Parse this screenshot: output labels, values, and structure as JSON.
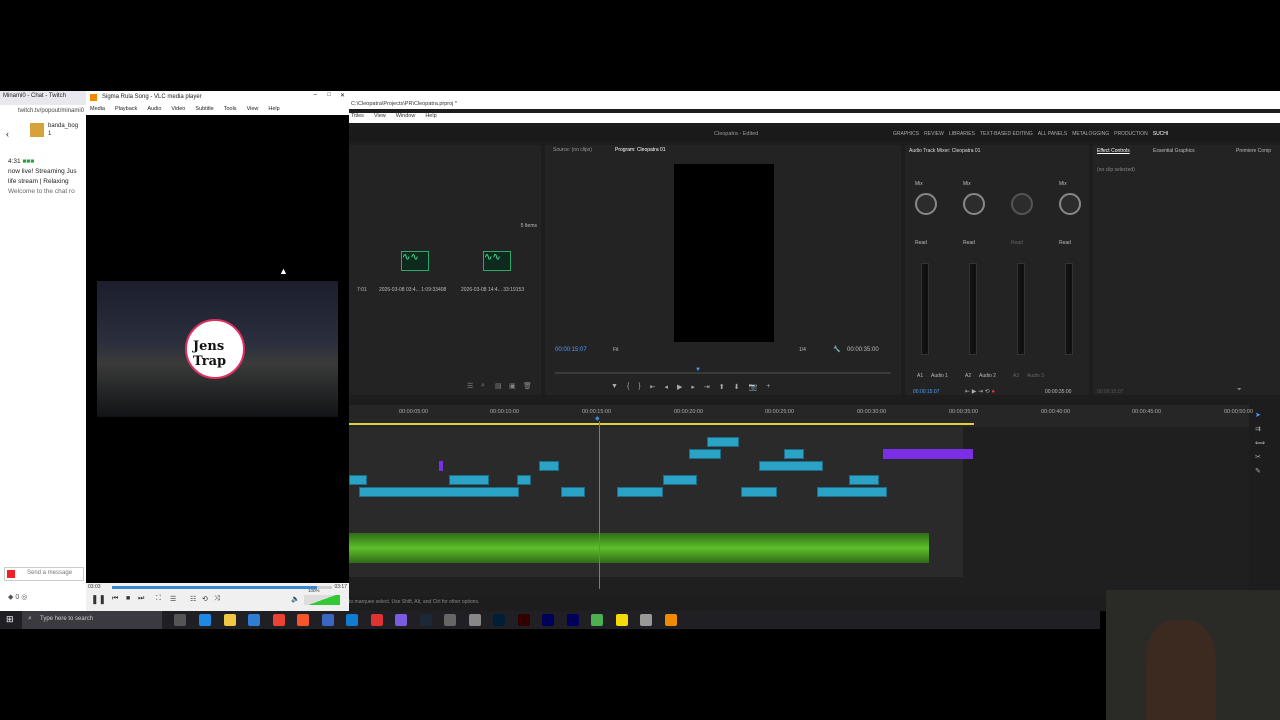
{
  "chat": {
    "tab_title": "Minami0 - Chat - Twitch",
    "url": "twitch.tv/popout/minami0",
    "user": "banda_bog",
    "user_sub": "1",
    "line_time": "4:31",
    "line1": "now live! Streaming Jus",
    "line2": "life stream | Relaxing",
    "welcome": "Welcome to the chat ro",
    "send_placeholder": "Send a message",
    "bottom_count": "0"
  },
  "vlc": {
    "title": "Sigma Rula Song - VLC media player",
    "menu": [
      "Media",
      "Playback",
      "Audio",
      "Video",
      "Subtitle",
      "Tools",
      "View",
      "Help"
    ],
    "logo_text": "Jens Trap",
    "time_elapsed": "03:03",
    "time_total": "03:17",
    "volume": "100%",
    "progress": 0.93
  },
  "premiere": {
    "title_path": "C:\\Cleopatra\\Projects\\PR\\Cleopatra.prproj *",
    "menu": [
      "Titles",
      "View",
      "Window",
      "Help"
    ],
    "project_name": "Cleopatra",
    "project_status": "Edited",
    "workspaces": [
      "GRAPHICS",
      "REVIEW",
      "LIBRARIES",
      "TEXT-BASED EDITING",
      "ALL PANELS",
      "METALOGGING",
      "PRODUCTION",
      "SUCHI"
    ],
    "source_tab": "Source: (no clips)",
    "program_tab": "Program: Cleopatra 01",
    "items_count": "5 Items",
    "bin_items": [
      {
        "name": "2026-03-08 03:4...",
        "dur": "1:09:33408"
      },
      {
        "name": "2026-03-08 14:4...",
        "dur": "33:19153"
      }
    ],
    "bin_left_dur": "7:01",
    "program_timecode": "00:00:15:07",
    "fit": "Fit",
    "quality": "1/4",
    "program_duration": "00:00:35:00",
    "mixer_title": "Audio Track Mixer: Cleopatra 01",
    "mixer_channels": [
      {
        "label": "A1",
        "name": "Audio 1",
        "mode": "Read",
        "mix": "Mix"
      },
      {
        "label": "A2",
        "name": "Audio 2",
        "mode": "Read",
        "mix": "Mix"
      },
      {
        "label": "A3",
        "name": "Audio 3",
        "mode": "Read",
        "mix": ""
      },
      {
        "label": "",
        "name": "",
        "mode": "Read",
        "mix": "Mix"
      }
    ],
    "mixer_timecode": "00:00:15:07",
    "mixer_end": "00:00:35:00",
    "effect_tabs": [
      "Effect Controls",
      "Essential Graphics",
      "Premiere Comp"
    ],
    "effect_status": "(no clip selected)",
    "effect_time": "00:00:15:07",
    "timeline_ticks": [
      "00:00:05:00",
      "00:00:10:00",
      "00:00:15:00",
      "00:00:20:00",
      "00:00:25:00",
      "00:00:30:00",
      "00:00:35:00",
      "00:00:40:00",
      "00:00:45:00",
      "00:00:50:00"
    ],
    "status_hint": "to marquee select. Use Shift, Alt, and Ctrl for other options."
  },
  "taskbar": {
    "search_placeholder": "Type here to search"
  },
  "colors": {
    "clip_blue": "#2aa3c7",
    "clip_purple": "#7a2fe6",
    "audio_green": "#5fbf2a",
    "playhead": "#3a8bd6",
    "workarea_yellow": "#e0d235"
  }
}
